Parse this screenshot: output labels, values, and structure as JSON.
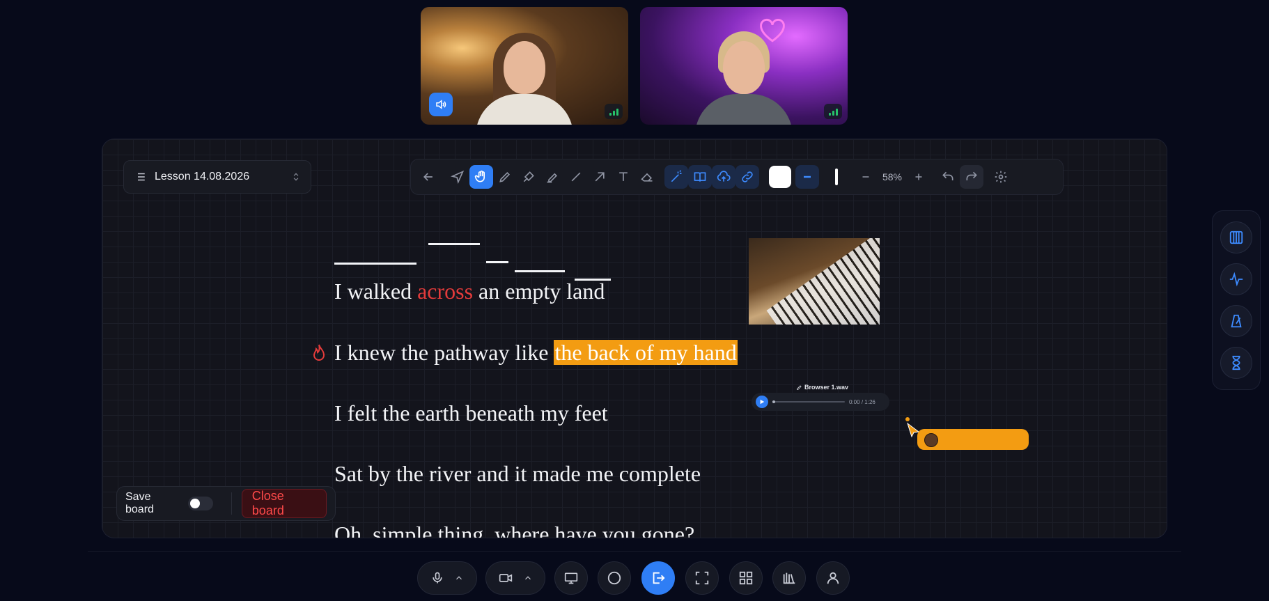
{
  "participants": [
    {
      "name": "participant-1",
      "speaking": true,
      "signal": "good"
    },
    {
      "name": "participant-2",
      "speaking": false,
      "signal": "good"
    }
  ],
  "board": {
    "lesson_title": "Lesson 14.08.2026",
    "zoom": "58%",
    "lyrics": [
      {
        "before": "I walked ",
        "highlight_red": "across",
        "after": " an empty land"
      },
      {
        "before": "I knew the pathway like ",
        "highlight_orange": "the back of my hand"
      },
      {
        "text": "I felt the earth beneath my feet"
      },
      {
        "text": "Sat by the river and it made me complete"
      },
      {
        "text": "Oh, simple thing, where have you gone?"
      }
    ],
    "audio": {
      "filename": "Browser 1.wav",
      "current": "0:00",
      "sep": "/",
      "duration": "1:26"
    },
    "save_label": "Save board",
    "save_enabled": false,
    "close_label": "Close board"
  },
  "colors": {
    "accent": "#2f7ef5",
    "highlight": "#f39c12",
    "red": "#e33b3b"
  },
  "toolbar_icons": [
    "arrow-left-icon",
    "pointer-icon",
    "hand-icon",
    "pencil-icon",
    "shapes-icon",
    "marker-icon",
    "line-icon",
    "arrow-icon",
    "text-icon",
    "eraser-icon",
    "magic-icon",
    "book-icon",
    "upload-icon",
    "link-icon",
    "color-swatch",
    "stroke-dash-icon",
    "stroke-width-icon",
    "zoom-out-icon",
    "zoom-in-icon",
    "undo-icon",
    "redo-icon",
    "settings-icon"
  ],
  "side_tools": [
    "piano-icon",
    "waveform-icon",
    "metronome-icon",
    "hourglass-icon"
  ],
  "bottom_controls": [
    "microphone-icon",
    "camera-icon",
    "screen-share-icon",
    "record-icon",
    "leave-icon",
    "fullscreen-icon",
    "grid-icon",
    "library-icon",
    "user-icon"
  ]
}
